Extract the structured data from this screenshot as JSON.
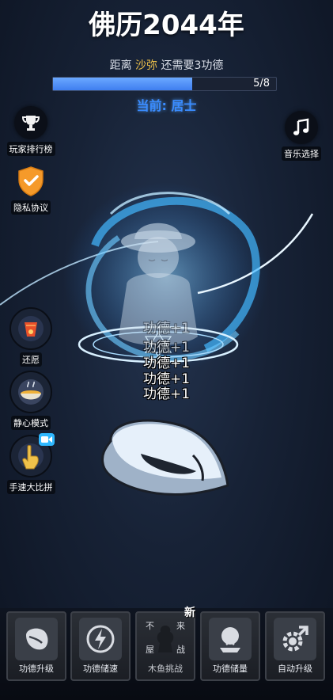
{
  "header": {
    "title": "佛历2044年",
    "distance_prefix": "距离",
    "next_rank": "沙弥",
    "distance_suffix": "还需要3功德",
    "progress_text": "5/8",
    "progress_fraction": 0.625,
    "current_rank": "当前: 居士"
  },
  "left_buttons": {
    "leaderboard": "玩家排行榜",
    "privacy": "隐私协议",
    "wish": "还愿",
    "calm_mode": "静心模式",
    "speed_contest": "手速大比拼"
  },
  "right_buttons": {
    "music": "音乐选择"
  },
  "merit_popups": [
    "功德+1",
    "功德+1",
    "功德+1",
    "功德+1",
    "功德+1"
  ],
  "bottom_tabs": {
    "upgrade": "功德升级",
    "storage_speed": "功德储速",
    "fish_challenge": "木鱼挑战",
    "storage_amount": "功德储量",
    "auto_upgrade": "自动升级"
  },
  "challenge_tile": {
    "chars": [
      "不",
      "来",
      "屋",
      "战"
    ],
    "new_badge": "新"
  },
  "colors": {
    "accent_gold": "#f0c24a",
    "progress_blue": "#3f7ef0",
    "current_rank_blue": "#3a8cff"
  }
}
